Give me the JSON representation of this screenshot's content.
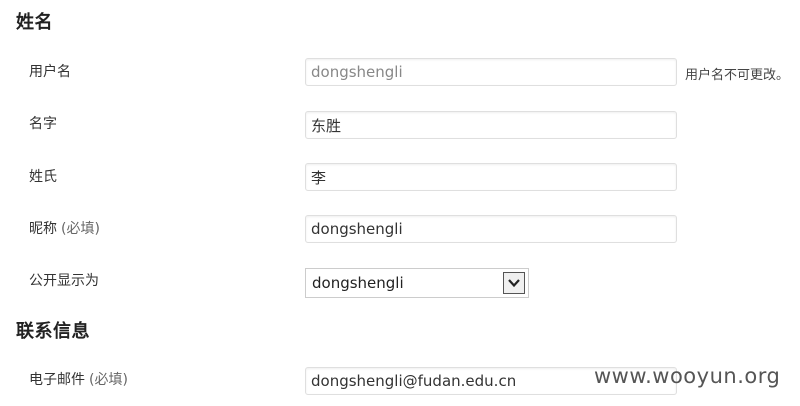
{
  "sections": {
    "name_title": "姓名",
    "contact_title": "联系信息"
  },
  "fields": {
    "username": {
      "label": "用户名",
      "value": "dongshengli",
      "hint": "用户名不可更改。"
    },
    "first_name": {
      "label": "名字",
      "value": "东胜"
    },
    "last_name": {
      "label": "姓氏",
      "value": "李"
    },
    "nickname": {
      "label": "昵称",
      "required": "(必填)",
      "value": "dongshengli"
    },
    "display_name": {
      "label": "公开显示为",
      "selected": "dongshengli"
    },
    "email": {
      "label": "电子邮件",
      "required": "(必填)",
      "value": "dongshengli@fudan.edu.cn"
    }
  },
  "watermark": "www.wooyun.org"
}
